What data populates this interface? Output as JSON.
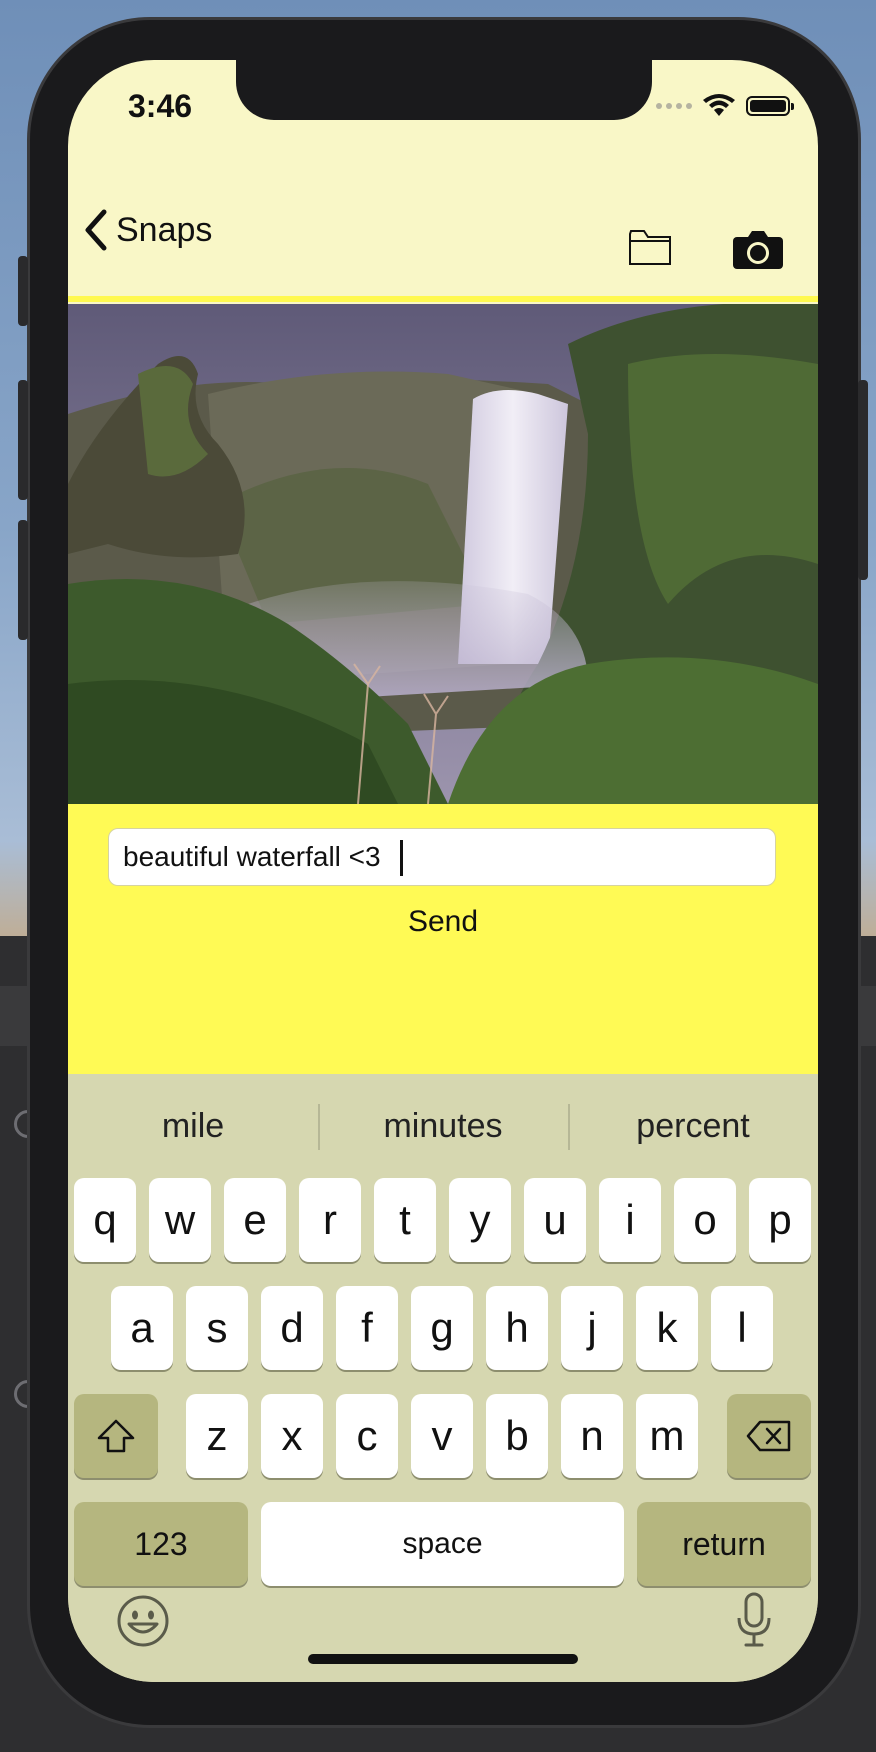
{
  "status_bar": {
    "time": "3:46"
  },
  "nav": {
    "back_label": "Snaps",
    "back_icon": "chevron-left-icon",
    "folder_icon": "folder-icon",
    "camera_icon": "camera-icon"
  },
  "photo": {
    "subject": "waterfall-photo"
  },
  "compose": {
    "caption_value": "beautiful waterfall <3",
    "send_label": "Send"
  },
  "keyboard": {
    "suggestions": [
      "mile",
      "minutes",
      "percent"
    ],
    "row1": [
      "q",
      "w",
      "e",
      "r",
      "t",
      "y",
      "u",
      "i",
      "o",
      "p"
    ],
    "row2": [
      "a",
      "s",
      "d",
      "f",
      "g",
      "h",
      "j",
      "k",
      "l"
    ],
    "row3": [
      "z",
      "x",
      "c",
      "v",
      "b",
      "n",
      "m"
    ],
    "numbers_label": "123",
    "space_label": "space",
    "return_label": "return",
    "shift_icon": "shift-icon",
    "delete_icon": "backspace-icon",
    "emoji_icon": "emoji-icon",
    "mic_icon": "microphone-icon"
  },
  "colors": {
    "navbar_bg": "#f9f7c7",
    "accent_yellow": "#fffa55",
    "keyboard_bg": "#d6d7b0",
    "dark_key": "#b5b67f"
  }
}
